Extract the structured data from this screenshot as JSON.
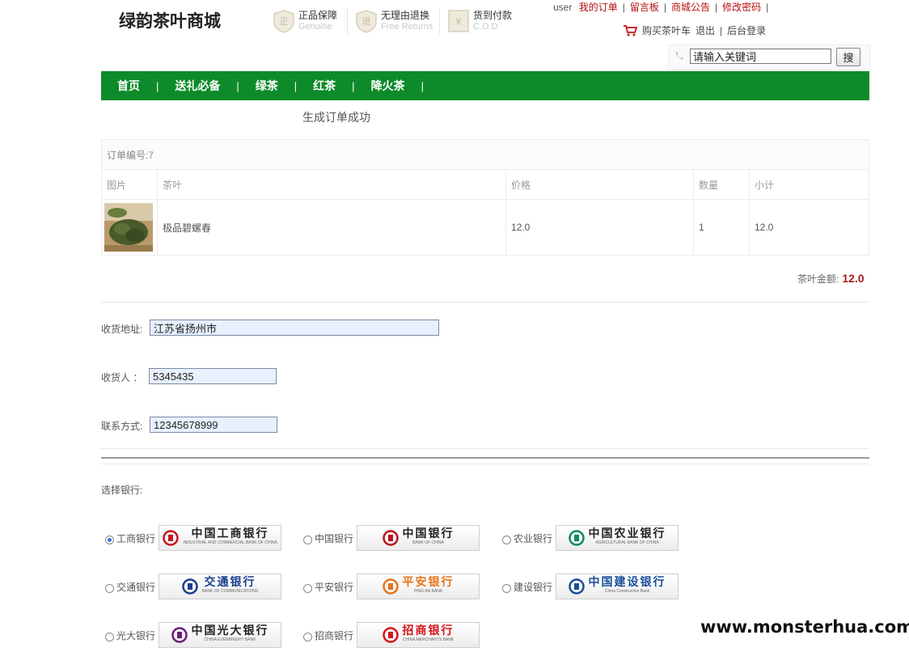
{
  "header": {
    "logo": "绿韵茶叶商城",
    "promos": [
      {
        "icon": "genuine-shield-icon",
        "main": "正品保障",
        "sub": "Genuine"
      },
      {
        "icon": "return-shield-icon",
        "main": "无理由退换",
        "sub": "Free Returns"
      },
      {
        "icon": "cod-icon",
        "main": "货到付款",
        "sub": "C.O.D"
      }
    ],
    "user": "user",
    "links": [
      "我的订单",
      "留言板",
      "商城公告",
      "修改密码"
    ],
    "cart": "购买茶叶车",
    "logout": "退出",
    "admin": "后台登录",
    "search": {
      "phone_hint": "",
      "value": "请输入关键词",
      "button": "搜"
    }
  },
  "nav": [
    "首页",
    "送礼必备",
    "绿茶",
    "红茶",
    "降火茶"
  ],
  "message": "生成订单成功",
  "order": {
    "number_label": "订单编号:7",
    "columns": [
      "图片",
      "茶叶",
      "价格",
      "数量",
      "小计"
    ],
    "rows": [
      {
        "name": "极品碧螺春",
        "price": "12.0",
        "qty": "1",
        "subtotal": "12.0"
      }
    ],
    "total_label": "茶叶金额:",
    "total": "12.0"
  },
  "form": {
    "address_label": "收货地址:",
    "address": "江苏省扬州市",
    "receiver_label": "收货人  ：",
    "receiver": "5345435",
    "contact_label": "联系方式:",
    "contact": "12345678999"
  },
  "banks": {
    "label": "选择银行:",
    "options": [
      {
        "name": "工商银行",
        "logo_main": "中国工商银行",
        "logo_sub": "INDUSTRIAL AND COMMERCIAL BANK OF CHINA",
        "color": "#c4161c",
        "selected": true
      },
      {
        "name": "中国银行",
        "logo_main": "中国银行",
        "logo_sub": "BANK OF CHINA",
        "color": "#b8131a",
        "selected": false
      },
      {
        "name": "农业银行",
        "logo_main": "中国农业银行",
        "logo_sub": "AGRICULTURAL BANK OF CHINA",
        "color": "#0a8a5a",
        "selected": false
      },
      {
        "name": "交通银行",
        "logo_main": "交通银行",
        "logo_sub": "BANK OF COMMUNICATIONS",
        "color": "#1a3d8f",
        "selected": false
      },
      {
        "name": "平安银行",
        "logo_main": "平安银行",
        "logo_sub": "PING AN BANK",
        "color": "#e8731a",
        "selected": false
      },
      {
        "name": "建设银行",
        "logo_main": "中国建设银行",
        "logo_sub": "China Construction Bank",
        "color": "#1b4e9c",
        "selected": false
      },
      {
        "name": "光大银行",
        "logo_main": "中国光大银行",
        "logo_sub": "CHINA EVERBRIGHT BANK",
        "color": "#6b1d7a",
        "selected": false
      },
      {
        "name": "招商银行",
        "logo_main": "招商银行",
        "logo_sub": "CHINA MERCHANTS BANK",
        "color": "#d6141c",
        "selected": false
      }
    ]
  },
  "watermark": "www.monsterhua.com"
}
